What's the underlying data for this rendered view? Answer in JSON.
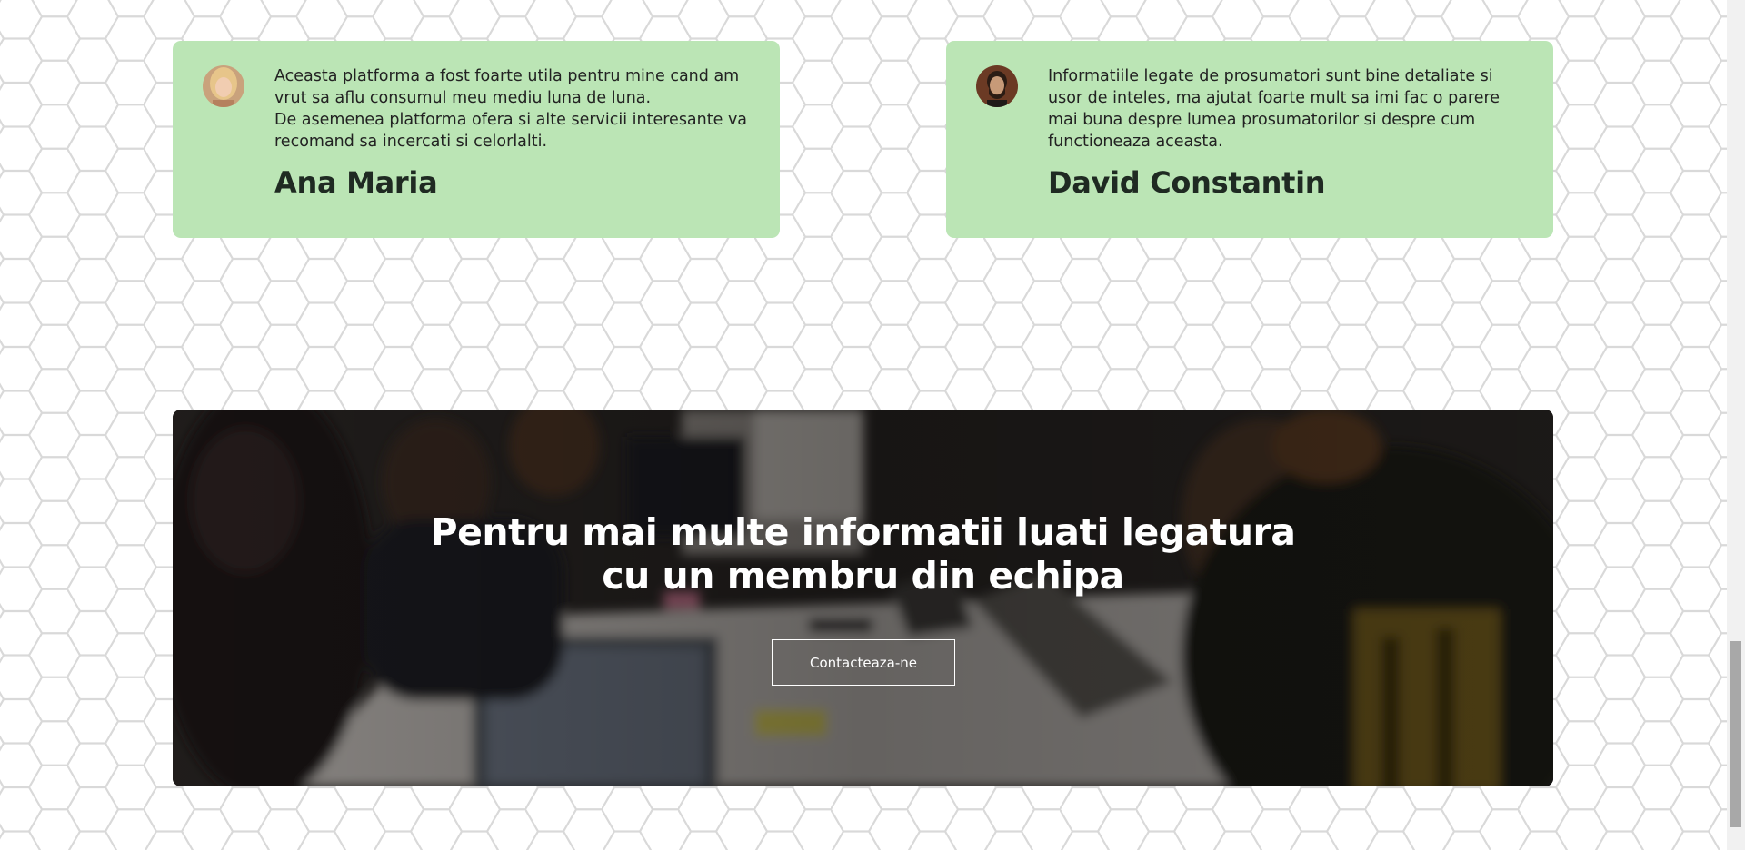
{
  "testimonials": [
    {
      "quote_lines": [
        "Aceasta platforma a fost foarte utila pentru mine cand am",
        "vrut sa aflu consumul meu mediu luna de luna.",
        "De asemenea platforma ofera si alte servicii interesante va",
        "recomand sa incercati si celorlalti."
      ],
      "author": "Ana Maria"
    },
    {
      "quote_lines": [
        "Informatiile legate de prosumatori sunt bine detaliate si",
        "usor de inteles, ma ajutat foarte mult sa imi fac o parere",
        "mai buna despre lumea prosumatorilor si despre cum",
        "functioneaza aceasta."
      ],
      "author": "David Constantin"
    }
  ],
  "cta": {
    "title_lines": [
      "Pentru mai multe informatii luati legatura",
      "cu un membru din echipa"
    ],
    "button_label": "Contacteaza-ne"
  },
  "colors": {
    "card_background": "#bbe5b5",
    "hex_pattern_stroke": "#d9d9d9",
    "cta_text": "#ffffff"
  }
}
